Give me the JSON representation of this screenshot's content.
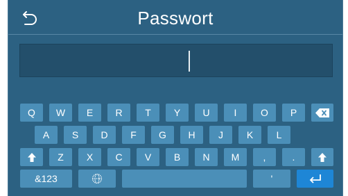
{
  "header": {
    "title": "Passwort",
    "back_icon": "back-arrow-icon"
  },
  "password_field": {
    "value": "",
    "placeholder": ""
  },
  "keyboard": {
    "row1": [
      "Q",
      "W",
      "E",
      "R",
      "T",
      "Y",
      "U",
      "I",
      "O",
      "P"
    ],
    "row2": [
      "A",
      "S",
      "D",
      "F",
      "G",
      "H",
      "J",
      "K",
      "L"
    ],
    "row3": [
      "Z",
      "X",
      "C",
      "V",
      "B",
      "N",
      "M",
      ",",
      "."
    ],
    "row4": {
      "numbers_label": "&123",
      "apostrophe": "'",
      "language_icon": "globe-icon",
      "enter_icon": "enter-icon"
    },
    "backspace_icon": "backspace-icon",
    "shift_icon": "shift-icon"
  },
  "colors": {
    "background": "#2c6182",
    "key": "#4b8fb8",
    "enter_key": "#1e86d6",
    "field": "#234f6b"
  }
}
